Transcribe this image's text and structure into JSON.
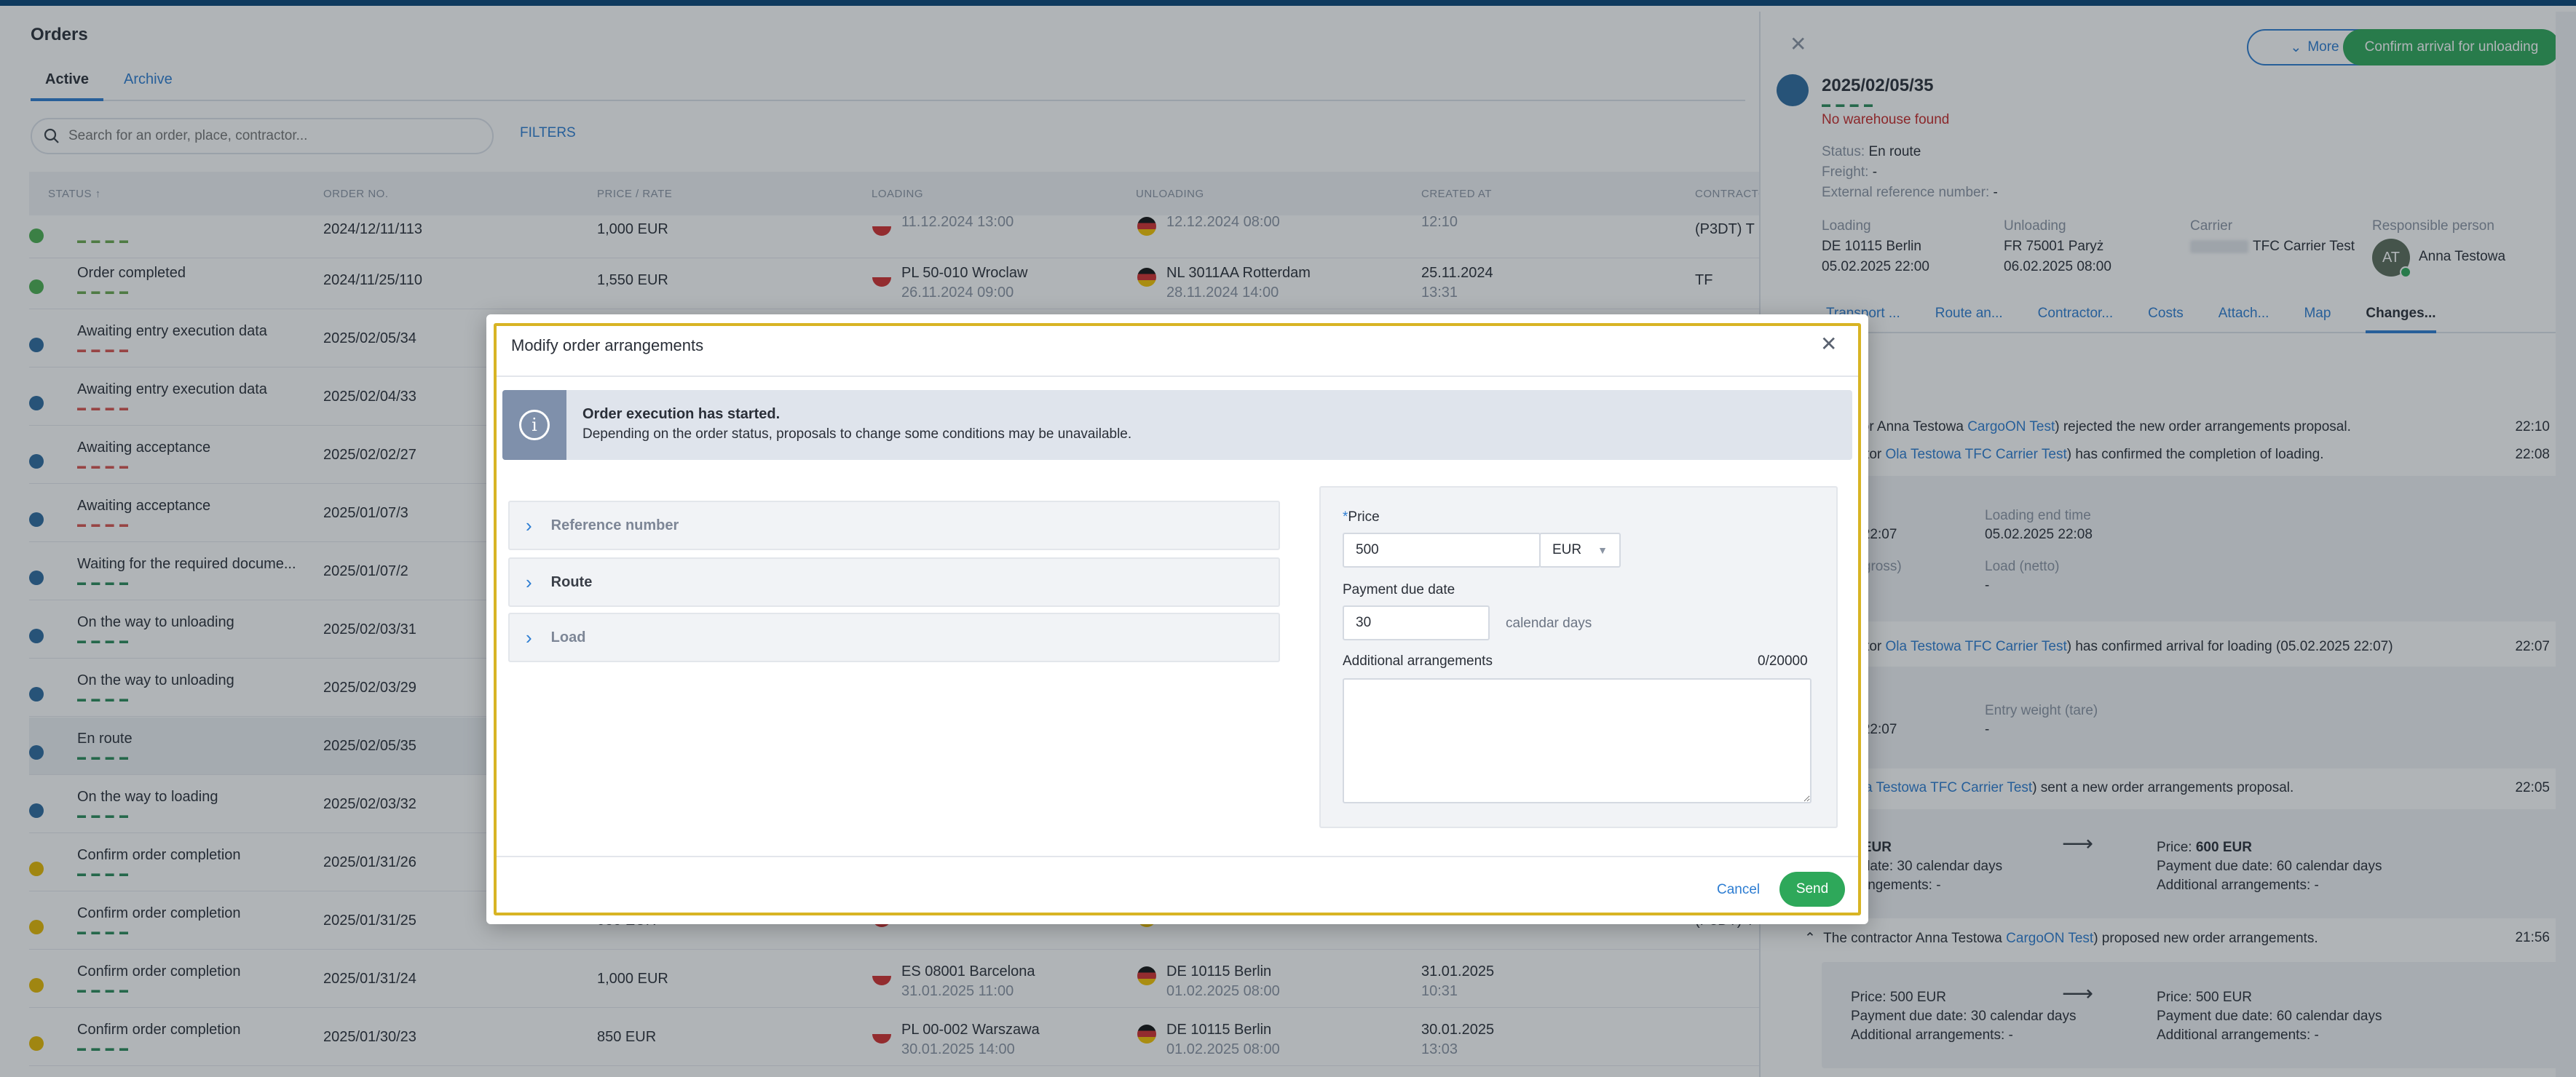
{
  "page": {
    "title": "Orders"
  },
  "tabs": [
    {
      "label": "Active"
    },
    {
      "label": "Archive"
    }
  ],
  "search": {
    "placeholder": "Search for an order, place, contractor..."
  },
  "filters_label": "FILTERS",
  "columns": [
    "STATUS",
    "ORDER NO.",
    "PRICE / RATE",
    "LOADING",
    "UNLOADING",
    "CREATED AT",
    "CONTRACTOR"
  ],
  "rows": [
    {
      "status": "",
      "order": "2024/12/11/113",
      "price": "1,000 EUR",
      "load_place": "",
      "load_date": "11.12.2024 13:00",
      "unload_place": "",
      "unload_date": "12.12.2024 08:00",
      "created_date": "",
      "created_time": "12:10",
      "contractor": "(P3DT) T"
    },
    {
      "status": "Order completed",
      "order": "2024/11/25/110",
      "price": "1,550 EUR",
      "load_place": "PL 50-010 Wroclaw",
      "load_date": "26.11.2024 09:00",
      "unload_place": "NL 3011AA Rotterdam",
      "unload_date": "28.11.2024 14:00",
      "created_date": "25.11.2024",
      "created_time": "13:31",
      "contractor": "TF"
    },
    {
      "status": "Awaiting entry execution data",
      "order": "2025/02/05/34"
    },
    {
      "status": "Awaiting entry execution data",
      "order": "2025/02/04/33"
    },
    {
      "status": "Awaiting acceptance",
      "order": "2025/02/02/27"
    },
    {
      "status": "Awaiting acceptance",
      "order": "2025/01/07/3"
    },
    {
      "status": "Waiting for the required docume...",
      "order": "2025/01/07/2"
    },
    {
      "status": "On the way to unloading",
      "order": "2025/02/03/31"
    },
    {
      "status": "On the way to unloading",
      "order": "2025/02/03/29"
    },
    {
      "status": "En route",
      "order": "2025/02/05/35"
    },
    {
      "status": "On the way to loading",
      "order": "2025/02/03/32"
    },
    {
      "status": "Confirm order completion",
      "order": "2025/01/31/26"
    },
    {
      "status": "Confirm order completion",
      "order": "2025/01/31/25",
      "price": "950 EUR",
      "load_place": "",
      "load_date": "31.01.2025 14:00",
      "unload_place": "",
      "unload_date": "01.02.2025 08:00",
      "created_date": "",
      "created_time": "13:25",
      "contractor": "(P3DT) T"
    },
    {
      "status": "Confirm order completion",
      "order": "2025/01/31/24",
      "price": "1,000 EUR",
      "load_place": "ES 08001 Barcelona",
      "load_date": "31.01.2025 11:00",
      "unload_place": "DE 10115 Berlin",
      "unload_date": "01.02.2025 08:00",
      "created_date": "31.01.2025",
      "created_time": "10:31",
      "contractor": ""
    },
    {
      "status": "Confirm order completion",
      "order": "2025/01/30/23",
      "price": "850 EUR",
      "load_place": "PL 00-002 Warszawa",
      "load_date": "30.01.2025 14:00",
      "unload_place": "DE 10115 Berlin",
      "unload_date": "01.02.2025 08:00",
      "created_date": "30.01.2025",
      "created_time": "13:03",
      "contractor": ""
    }
  ],
  "panel": {
    "more_label": "More",
    "confirm_label": "Confirm arrival for unloading",
    "order_id": "2025/02/05/35",
    "warning": "No warehouse found",
    "status_label": "Status:",
    "status_value": "En route",
    "freight_label": "Freight:",
    "freight_value": "-",
    "ext_label": "External reference number:",
    "ext_value": "-",
    "loading_label": "Loading",
    "loading_place": "DE 10115 Berlin",
    "loading_date": "05.02.2025 22:00",
    "unloading_label": "Unloading",
    "unloading_place": "FR 75001 Paryż",
    "unloading_date": "06.02.2025 08:00",
    "carrier_label": "Carrier",
    "carrier_value": "TFC Carrier Test",
    "resp_label": "Responsible person",
    "resp_initials": "AT",
    "resp_name": "Anna Testowa",
    "tabs": [
      "Transport ...",
      "Route an...",
      "Contractor...",
      "Costs",
      "Attach...",
      "Map",
      "Changes..."
    ],
    "log": [
      {
        "text": "ctor Anna Testowa",
        "link": "CargoON Test",
        "rest": ") rejected the new order arrangements proposal.",
        "time": "22:10"
      },
      {
        "text": "actor ",
        "link": "Ola Testowa",
        "link2": "TFC Carrier Test",
        "rest": ") has confirmed the completion of loading.",
        "time": "22:08"
      },
      {
        "text": "actor ",
        "link": "Ola Testowa",
        "link2": "TFC Carrier Test",
        "rest": ") has confirmed arrival for loading (05.02.2025 22:07)",
        "time": "22:07"
      },
      {
        "text": "",
        "link": "Ola Testowa",
        "link2": "TFC Carrier Test",
        "rest": ") sent a new order arrangements proposal.",
        "time": "22:05"
      },
      {
        "text": "The contractor Anna Testowa",
        "link": "CargoON Test",
        "rest": ") proposed new order arrangements.",
        "time": "21:56"
      }
    ],
    "g1": {
      "left_val": "5 22:07",
      "load_end_label": "Loading end time",
      "load_end_val": "05.02.2025 22:08",
      "gross_label": "t (gross)",
      "netto_label": "Load (netto)",
      "netto_val": "-"
    },
    "g2": {
      "left_val": "5 22:07",
      "tare_label": "Entry weight (tare)",
      "tare_val": "-"
    },
    "g3": {
      "l_price": "0 EUR",
      "l_due": "e date:  30 calendar days",
      "l_add": "rrangements:  -",
      "r_price_label": "Price:",
      "r_price": "600 EUR",
      "r_due": "Payment due date:  60 calendar days",
      "r_add": "Additional arrangements:  -"
    },
    "g4": {
      "l_price": "Price:  500 EUR",
      "l_due": "Payment due date:  30 calendar days",
      "l_add": "Additional arrangements:  -",
      "r_price": "Price:  500 EUR",
      "r_due": "Payment due date:  60 calendar days",
      "r_add": "Additional arrangements:  -"
    }
  },
  "modal": {
    "title": "Modify order arrangements",
    "info_title": "Order execution has started.",
    "info_text": "Depending on the order status, proposals to change some conditions may be unavailable.",
    "sections": [
      "Reference number",
      "Route",
      "Load"
    ],
    "price_label": "Price",
    "price_value": "500",
    "currency": "EUR",
    "due_label": "Payment due date",
    "due_value": "30",
    "due_unit": "calendar days",
    "add_label": "Additional arrangements",
    "add_counter": "0/20000",
    "add_value": "",
    "cancel_label": "Cancel",
    "send_label": "Send"
  }
}
